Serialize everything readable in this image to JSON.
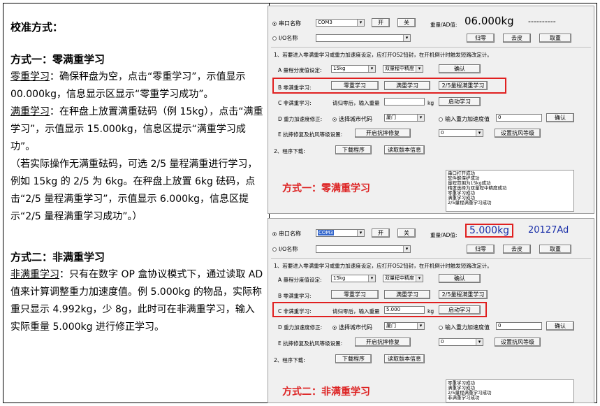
{
  "left": {
    "title": "校准方式：",
    "method1_title": "方式一：零满重学习",
    "zero_term": "零重学习",
    "zero_text": "：确保秤盘为空，点击“零重学习”，示值显示 00.000kg，信息显示区显示“零重学习成功”。",
    "full_term": "满重学习",
    "full_text": "：在秤盘上放置满重砝码（例 15kg），点击“满重学习”，示值显示 15.000kg，信息区提示“满重学习成功”。",
    "note_text": "（若实际操作无满重砝码，可选 2/5 量程满重进行学习，例如 15kg 的 2/5 为 6kg。在秤盘上放置 6kg 砝码，点击“2/5 量程满重学习”，示值显示 6.000kg，信息区提示“2/5 量程满重学习成功”。）",
    "method2_title": "方式二：非满重学习",
    "nonfull_term": "非满重学习",
    "nonfull_text": "：只有在数字 OP 盒协议模式下，通过读取 AD 值来计算调整重力加速度值。例 5.000kg 的物品，实际称重只显示 4.992kg，少 8g，此时可在非满重学习，输入实际重量 5.000kg 进行修正学习。"
  },
  "panel1": {
    "serial_label": "串口名称",
    "serial_value": "COM3",
    "open_btn": "开",
    "close_btn": "关",
    "weight_ad_label": "重量/AD值:",
    "weight_value": "06.000kg",
    "ad_value": "----------",
    "io_label": "I/O名称",
    "zero_btn": "归零",
    "tare_btn": "去皮",
    "cancel_btn": "取重",
    "instruction": "1、若要进入零满重学习或重力加速度设定，应打开OS2铅封，在开机倒计时触发短路改定计。",
    "rowA_label": "A 量程分度值设定:",
    "rowA_sel1": "15kg",
    "rowA_sel2": "双量程中精度",
    "rowA_btn": "确认",
    "rowB_label": "B 零满重学习:",
    "rowB_btn1": "零重学习",
    "rowB_btn2": "满重学习",
    "rowB_btn3": "2/5量程满重学习",
    "rowC_label": "C 非满重学习:",
    "rowC_hint": "请归零后，输入重量",
    "rowC_value": "",
    "rowC_unit": "kg",
    "rowC_btn": "启动学习",
    "rowD_label": "D 重力加速度修正:",
    "rowD_radio1": "选择城市代码",
    "rowD_city": "厦门",
    "rowD_radio2": "输入重力加速度值",
    "rowD_value": "0",
    "rowD_btn": "确认",
    "rowE_label": "E 抗摔修复及抗风等级设置:",
    "rowE_btn1": "开启抗摔修复",
    "rowE_sel": "0",
    "rowE_btn2": "设置抗风等级",
    "row2_label": "2、程序下载:",
    "row2_btn1": "下载程序",
    "row2_btn2": "读取版本信息",
    "log": [
      "串口打开成功",
      "软件解保护成功",
      "量程范围为15kg成功",
      "精度选择为双量程中精度成功",
      "零重学习成功",
      "满重学习成功",
      "2/5量程满重学习成功"
    ],
    "caption": "方式一：零满重学习"
  },
  "panel2": {
    "serial_label": "串口名称",
    "serial_value": "COM3",
    "open_btn": "开",
    "close_btn": "关",
    "weight_ad_label": "重量/AD值:",
    "weight_value": "5.000kg",
    "ad_value": "20127Ad",
    "io_label": "I/O名称",
    "zero_btn": "归零",
    "tare_btn": "去皮",
    "cancel_btn": "取重",
    "instruction": "1、若要进入零满重学习或重力加速度设定，应打开OS2铅封，在开机倒计时触发短路改定计。",
    "rowA_label": "A 量程分度值设定:",
    "rowA_sel1": "15kg",
    "rowA_sel2": "双量程中精度",
    "rowA_btn": "确认",
    "rowB_label": "B 零满重学习:",
    "rowB_btn1": "零重学习",
    "rowB_btn2": "满重学习",
    "rowB_btn3": "2/5量程满重学习",
    "rowC_label": "C 非满重学习:",
    "rowC_hint": "请归零后，输入重量",
    "rowC_value": "5.000",
    "rowC_unit": "kg",
    "rowC_btn": "启动学习",
    "rowD_label": "D 重力加速度修正:",
    "rowD_radio1": "选择城市代码",
    "rowD_city": "厦门",
    "rowD_radio2": "输入重力加速度值",
    "rowD_value": "0",
    "rowD_btn": "确认",
    "rowE_label": "E 抗摔修复及抗风等级设置:",
    "rowE_btn1": "开启抗摔修复",
    "rowE_sel": "0",
    "rowE_btn2": "设置抗风等级",
    "row2_label": "2、程序下载:",
    "row2_btn1": "下载程序",
    "row2_btn2": "读取版本信息",
    "log": [
      "零重学习成功",
      "满重学习成功",
      "2/5量程满重学习成功",
      "非满重学习成功"
    ],
    "caption": "方式二：非满重学习"
  },
  "colors": {
    "red": "#e02020",
    "blue": "#1a2fa8",
    "caption": "#d22222"
  }
}
